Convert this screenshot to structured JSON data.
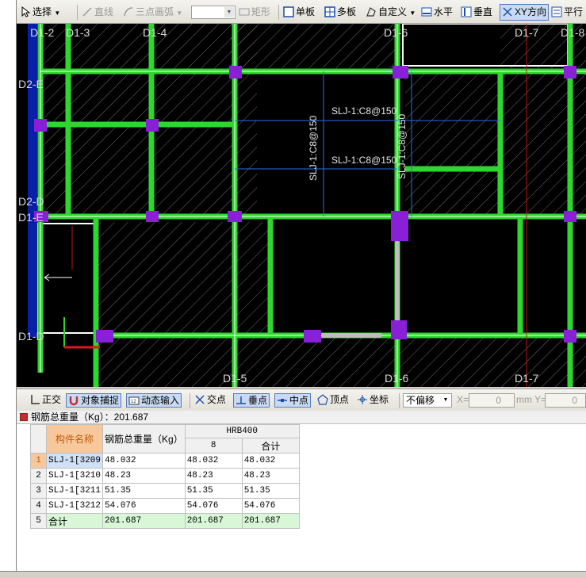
{
  "toolbar": {
    "select": "选择",
    "line": "直线",
    "arc": "三点画弧",
    "rect": "矩形",
    "single": "单板",
    "multi": "多板",
    "custom": "自定义",
    "horizontal": "水平",
    "vertical": "垂直",
    "xy_dir": "XY方向",
    "parallel": "平行"
  },
  "canvas": {
    "axis_labels": [
      "D1-2",
      "D1-3",
      "D1-4",
      "D1-6",
      "D1-7",
      "D1-8",
      "D2-E",
      "D2-D",
      "D1-E",
      "D1-D",
      "D1-5",
      "D1-6",
      "D1-7"
    ],
    "rebar_labels": [
      "SLJ-1:C8@150",
      "SLJ-1:C8@150",
      "SLJ-1:C8@150",
      "SLJ-1:C8@150"
    ]
  },
  "snap": {
    "ortho": "正交",
    "snap_obj": "对象捕捉",
    "dyn_input": "动态输入",
    "intersect": "交点",
    "perp": "垂点",
    "mid": "中点",
    "vertex": "顶点",
    "coord": "坐标",
    "offset": "不偏移",
    "x_label": "X=",
    "x_val": "0",
    "mm": "mm Y=",
    "y_val": "0"
  },
  "table": {
    "title": "钢筋总重量（Kg）：201.687",
    "col_name": "构件名称",
    "col_total": "钢筋总重量（Kg）",
    "col_grade": "HRB400",
    "col_8": "8",
    "col_sum": "合计",
    "rows": [
      {
        "idx": "1",
        "name": "SLJ-1[3209",
        "total": "48.032",
        "d8": "48.032",
        "sum": "48.032"
      },
      {
        "idx": "2",
        "name": "SLJ-1[3210",
        "total": "48.23",
        "d8": "48.23",
        "sum": "48.23"
      },
      {
        "idx": "3",
        "name": "SLJ-1[3211",
        "total": "51.35",
        "d8": "51.35",
        "sum": "51.35"
      },
      {
        "idx": "4",
        "name": "SLJ-1[3212",
        "total": "54.076",
        "d8": "54.076",
        "sum": "54.076"
      },
      {
        "idx": "5",
        "name": "合计",
        "total": "201.687",
        "d8": "201.687",
        "sum": "201.687"
      }
    ]
  }
}
